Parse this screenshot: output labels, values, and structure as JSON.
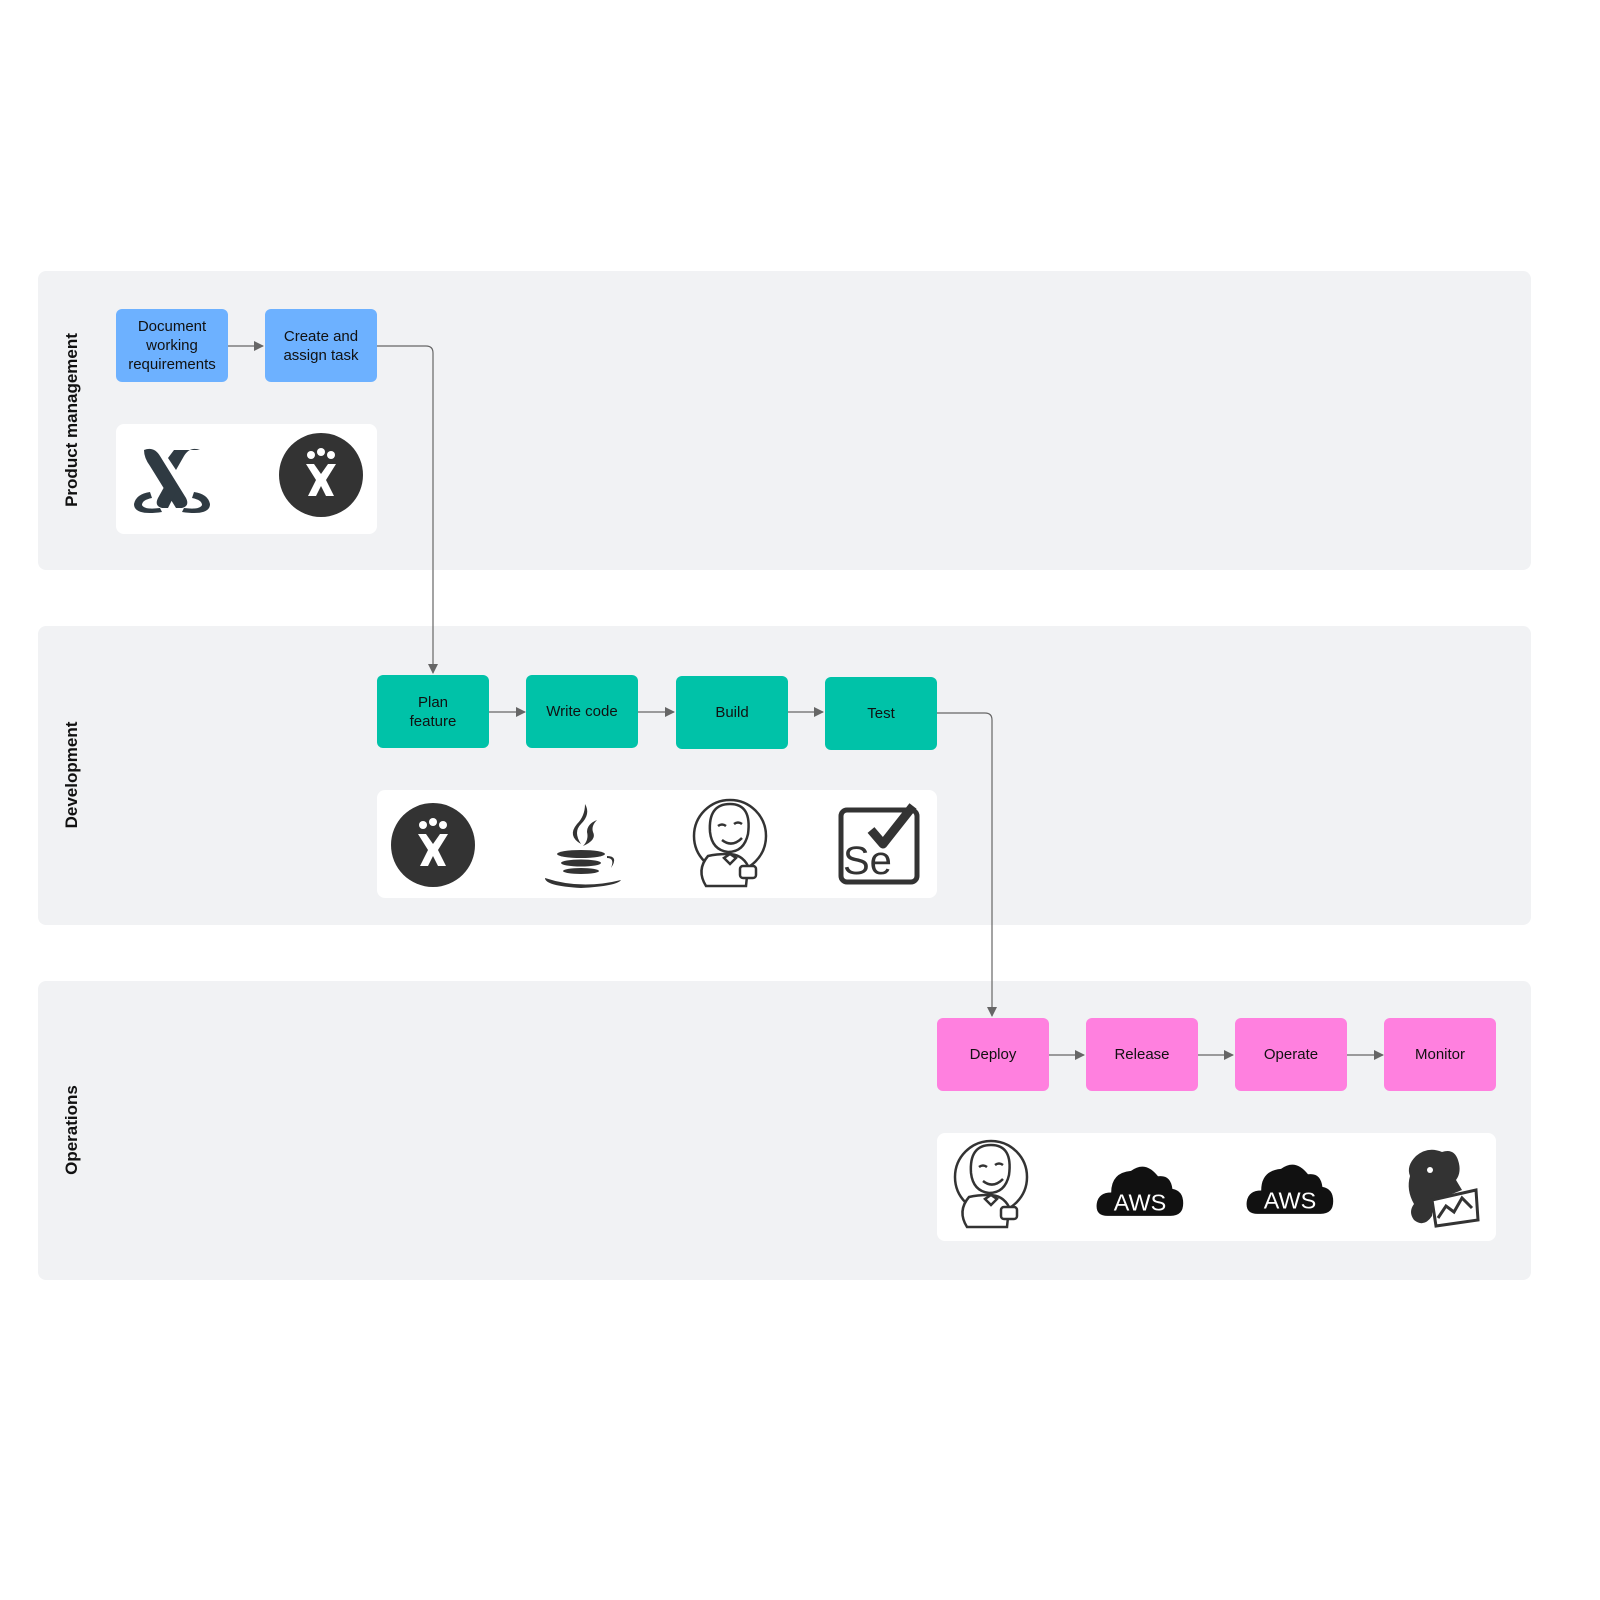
{
  "lanes": [
    {
      "label": "Product management"
    },
    {
      "label": "Development"
    },
    {
      "label": "Operations"
    }
  ],
  "nodes": {
    "pm": [
      "Document working requirements",
      "Create and assign task"
    ],
    "dev": [
      "Plan feature",
      "Write code",
      "Build",
      "Test"
    ],
    "ops": [
      "Deploy",
      "Release",
      "Operate",
      "Monitor"
    ]
  },
  "tools": {
    "pm": [
      "confluence-icon",
      "jira-icon"
    ],
    "dev": [
      "jira-icon",
      "java-icon",
      "jenkins-icon",
      "selenium-icon"
    ],
    "ops": [
      "jenkins-icon",
      "aws-icon",
      "aws-icon",
      "datadog-icon"
    ]
  },
  "icon_text": {
    "aws": "AWS",
    "selenium": "Se"
  },
  "colors": {
    "lane_bg": "#f1f2f4",
    "pm_node": "#6db1ff",
    "dev_node": "#00c2a8",
    "ops_node": "#ff80df",
    "connector": "#666666",
    "icon_dark": "#333333"
  }
}
